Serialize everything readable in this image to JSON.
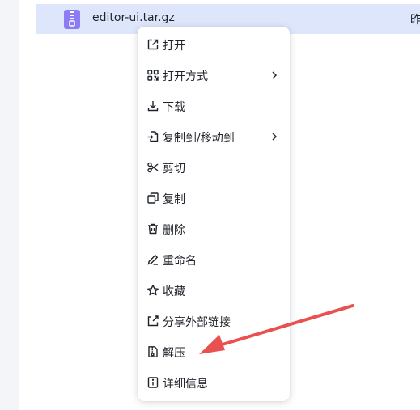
{
  "file": {
    "name": "editor-ui.tar.gz",
    "date_fragment": "昨",
    "icon": "archive-file-icon"
  },
  "menu": {
    "items": [
      {
        "label": "打开",
        "icon": "open-external-icon",
        "submenu": false
      },
      {
        "label": "打开方式",
        "icon": "open-with-grid-icon",
        "submenu": true
      },
      {
        "label": "下载",
        "icon": "download-icon",
        "submenu": false
      },
      {
        "label": "复制到/移动到",
        "icon": "copy-move-to-icon",
        "submenu": true
      },
      {
        "label": "剪切",
        "icon": "scissors-icon",
        "submenu": false
      },
      {
        "label": "复制",
        "icon": "copy-icon",
        "submenu": false
      },
      {
        "label": "删除",
        "icon": "trash-icon",
        "submenu": false
      },
      {
        "label": "重命名",
        "icon": "pencil-icon",
        "submenu": false
      },
      {
        "label": "收藏",
        "icon": "star-icon",
        "submenu": false
      },
      {
        "label": "分享外部链接",
        "icon": "share-external-icon",
        "submenu": false
      },
      {
        "label": "解压",
        "icon": "unzip-icon",
        "submenu": false
      },
      {
        "label": "详细信息",
        "icon": "info-icon",
        "submenu": false
      }
    ]
  },
  "colors": {
    "selected_row": "#dde6fb",
    "annotation_arrow": "#e8514f",
    "archive_icon": "#8b7cf6"
  }
}
